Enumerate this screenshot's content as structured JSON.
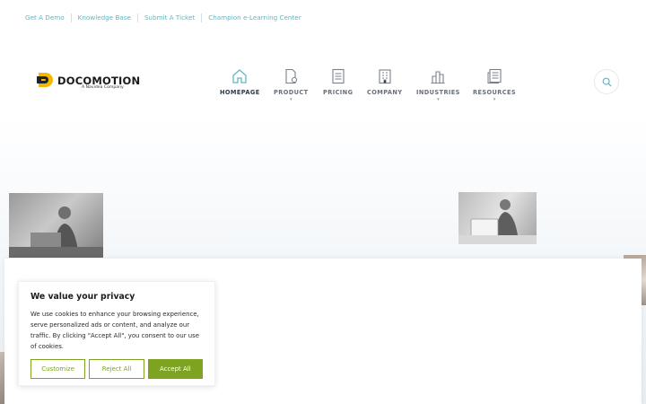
{
  "topbar": {
    "links": [
      "Get A Demo",
      "Knowledge Base",
      "Submit A Ticket",
      "Champion e-Learning Center"
    ]
  },
  "logo": {
    "brand": "DOCOMOTION",
    "tagline": "A Navidea Company",
    "accent": "#f5b800"
  },
  "nav": {
    "items": [
      {
        "label": "HOMEPAGE",
        "icon": "home-icon",
        "active": true,
        "dropdown": false
      },
      {
        "label": "PRODUCT",
        "icon": "document-gear-icon",
        "active": false,
        "dropdown": true
      },
      {
        "label": "PRICING",
        "icon": "checklist-icon",
        "active": false,
        "dropdown": false
      },
      {
        "label": "COMPANY",
        "icon": "building-icon",
        "active": false,
        "dropdown": false
      },
      {
        "label": "INDUSTRIES",
        "icon": "city-icon",
        "active": false,
        "dropdown": true
      },
      {
        "label": "RESOURCES",
        "icon": "article-icon",
        "active": false,
        "dropdown": true
      }
    ],
    "caret": "▾"
  },
  "search": {
    "icon": "search-icon",
    "color": "#62b6c7"
  },
  "cookie": {
    "title": "We value your privacy",
    "body": "We use cookies to enhance your browsing experience, serve personalized ads or content, and analyze our traffic. By clicking \"Accept All\", you consent to our use of cookies.",
    "customize_label": "Customize",
    "reject_label": "Reject All",
    "accept_label": "Accept All",
    "accent": "#7ea320"
  }
}
